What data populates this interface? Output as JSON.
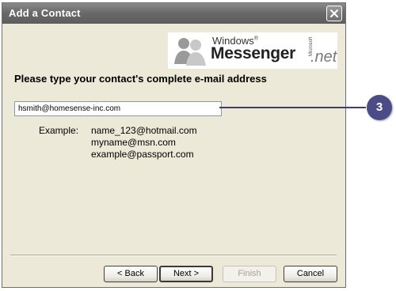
{
  "window": {
    "title": "Add a Contact",
    "close_icon": "close-icon"
  },
  "logo": {
    "windows": "Windows",
    "registered": "®",
    "messenger": "Messenger",
    "microsoft": "Microsoft",
    "net": ".net",
    "icon": "messenger-people-icon"
  },
  "heading": "Please type your contact's complete e-mail address",
  "email_field": {
    "value": "hsmith@homesense-inc.com",
    "placeholder": ""
  },
  "example": {
    "label": "Example:",
    "items": [
      "name_123@hotmail.com",
      "myname@msn.com",
      "example@passport.com"
    ]
  },
  "buttons": {
    "back": "< Back",
    "next": "Next >",
    "finish": "Finish",
    "cancel": "Cancel"
  },
  "callout": {
    "number": "3"
  },
  "colors": {
    "titlebar": "#6a6a6a",
    "dialog_bg": "#ece9d8",
    "callout": "#4b4b86"
  }
}
